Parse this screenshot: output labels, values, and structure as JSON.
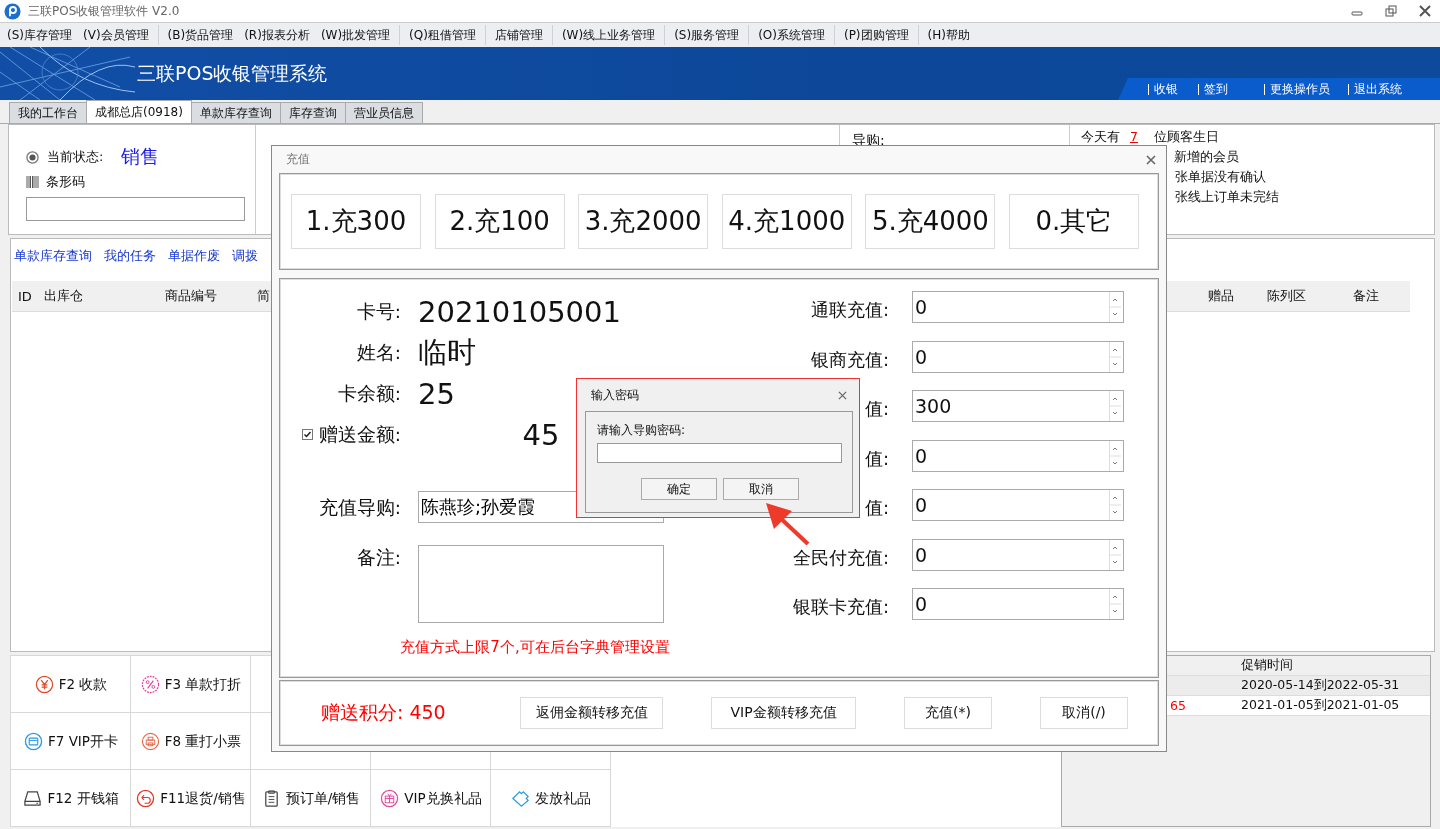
{
  "window": {
    "title": "三联POS收银管理软件 V2.0"
  },
  "menu": [
    [
      "(S)库存管理",
      "(V)会员管理"
    ],
    [
      "(B)货品管理",
      "(R)报表分析",
      "(W)批发管理"
    ],
    [
      "(Q)租借管理"
    ],
    [
      "店铺管理"
    ],
    [
      "(W)线上业务管理"
    ],
    [
      "(S)服务管理"
    ],
    [
      "(O)系统管理"
    ],
    [
      "(P)团购管理"
    ],
    [
      "(H)帮助"
    ]
  ],
  "banner": {
    "title": "三联POS收银管理系统",
    "links": [
      "收银",
      "签到",
      "更换操作员",
      "退出系统"
    ]
  },
  "tabs": [
    {
      "label": "我的工作台",
      "selected": false
    },
    {
      "label": "成都总店(0918)",
      "selected": true
    },
    {
      "label": "单款库存查询",
      "selected": false
    },
    {
      "label": "库存查询",
      "selected": false
    },
    {
      "label": "营业员信息",
      "selected": false
    }
  ],
  "status": {
    "label": "当前状态:",
    "value": "销售",
    "selected": true
  },
  "barcode": {
    "label": "条形码"
  },
  "guide_label": "导购:",
  "birthday": {
    "prefix": "今天有",
    "count": "7",
    "suffix": "位顾客生日"
  },
  "notice_lines": [
    "新增的会员",
    "张单据没有确认",
    "张线上订单未完结"
  ],
  "links": [
    "单款库存查询",
    "我的任务",
    "单据作废",
    "调拨"
  ],
  "table": {
    "columns_left": [
      "ID",
      "出库仓",
      "商品编号",
      "简"
    ],
    "columns_right": [
      "赠品",
      "陈列区",
      "备注"
    ]
  },
  "function_rows": [
    [
      {
        "label": "F2 收款",
        "kind": "cash"
      },
      {
        "label": "F3 单款打折",
        "kind": "discount"
      }
    ],
    [
      {
        "label": "F7 VIP开卡",
        "kind": "card"
      },
      {
        "label": "F8 重打小票",
        "kind": "printer"
      }
    ],
    [
      {
        "label": "F12 开钱箱",
        "kind": "drawer"
      },
      {
        "label": "F11退货/销售",
        "kind": "return"
      },
      {
        "label": "预订单/销售",
        "kind": "clipboard"
      },
      {
        "label": "VIP兑换礼品",
        "kind": "gift"
      },
      {
        "label": "发放礼品",
        "kind": "ticket"
      }
    ]
  ],
  "promo_table": {
    "column": "促销时间",
    "rows": [
      {
        "period": "2020-05-14到2022-05-31"
      },
      {
        "column_1": "65",
        "period": "2021-01-05到2021-01-05"
      }
    ]
  },
  "recharge": {
    "title": "充值",
    "presets": [
      "1.充300",
      "2.充100",
      "3.充2000",
      "4.充1000",
      "5.充4000",
      "0.其它"
    ],
    "info": [
      {
        "label": "卡号:",
        "value": "20210105001"
      },
      {
        "label": "姓名:",
        "value": "临时"
      },
      {
        "label": "卡余额:",
        "value": "25"
      }
    ],
    "gift": {
      "label": "赠送金额:",
      "value": "45",
      "checked": true
    },
    "guide": {
      "label": "充值导购:",
      "value": "陈燕珍;孙爱霞"
    },
    "remark": {
      "label": "备注:"
    },
    "notice": "充值方式上限7个,可在后台字典管理设置",
    "channels": [
      {
        "label": "通联充值:",
        "value": "0"
      },
      {
        "label": "银商充值:",
        "value": "0"
      },
      {
        "label": "值:",
        "value": "300"
      },
      {
        "label": "值:",
        "value": "0"
      },
      {
        "label": "值:",
        "value": "0"
      },
      {
        "label": "全民付充值:",
        "value": "0"
      },
      {
        "label": "银联卡充值:",
        "value": "0"
      }
    ],
    "bonus_points": "赠送积分: 450",
    "buttons": [
      "返佣金额转移充值",
      "VIP金额转移充值",
      "充值(*)",
      "取消(/)"
    ]
  },
  "password": {
    "title": "输入密码",
    "prompt": "请输入导购密码:",
    "buttons": [
      "确定",
      "取消"
    ]
  }
}
